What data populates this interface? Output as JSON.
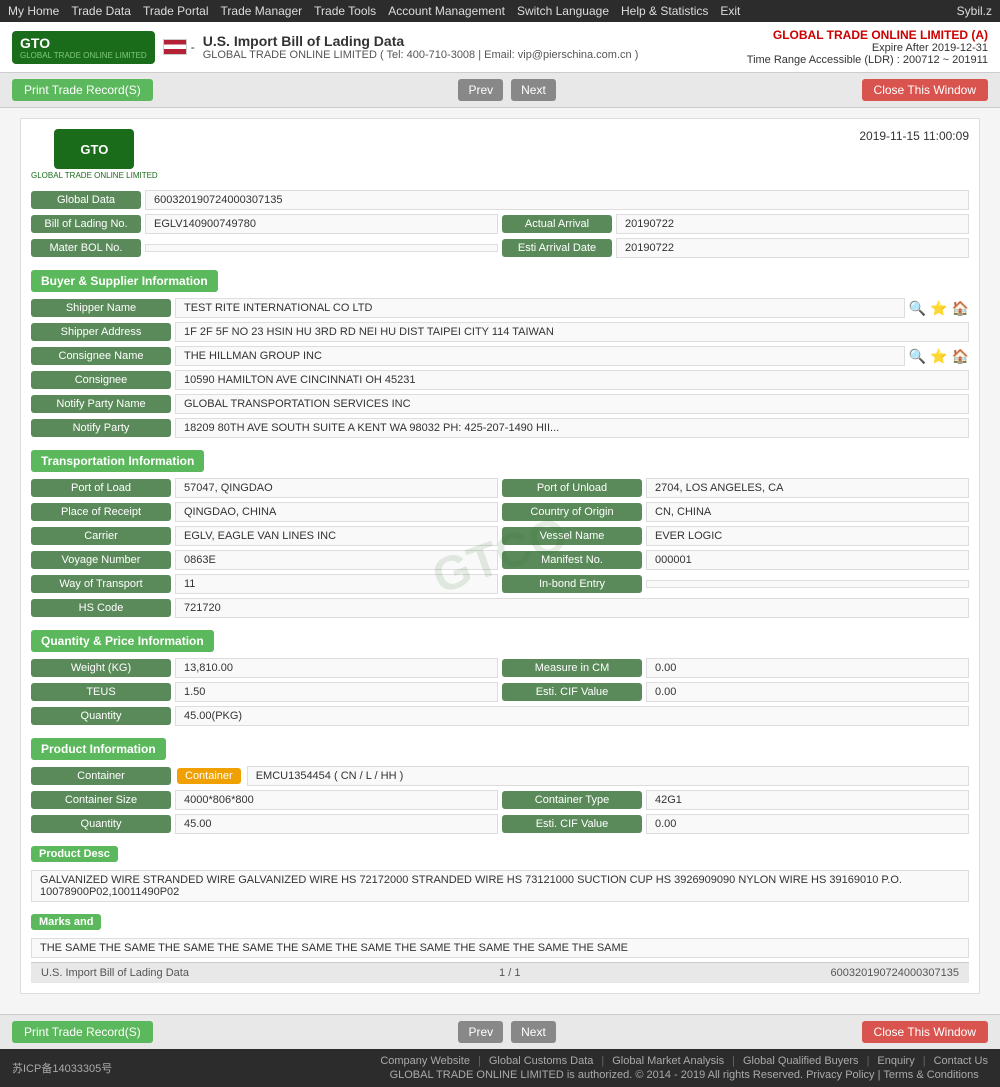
{
  "topnav": {
    "items": [
      "My Home",
      "Trade Data",
      "Trade Portal",
      "Trade Manager",
      "Trade Tools",
      "Account Management",
      "Switch Language",
      "Help & Statistics",
      "Exit"
    ],
    "user": "Sybil.z"
  },
  "header": {
    "logo": "GTO",
    "logo_sub": "GLOBAL TRADE ONLINE LIMITED",
    "title": "U.S. Import Bill of Lading Data",
    "subtitle": "GLOBAL TRADE ONLINE LIMITED ( Tel: 400-710-3008 | Email: vip@pierschina.com.cn )",
    "company": "GLOBAL TRADE ONLINE LIMITED (A)",
    "expire": "Expire After 2019-12-31",
    "time_range": "Time Range Accessible (LDR) : 200712 ~ 201911"
  },
  "toolbar": {
    "print_label": "Print Trade Record(S)",
    "prev_label": "Prev",
    "next_label": "Next",
    "close_label": "Close This Window"
  },
  "card": {
    "timestamp": "2019-11-15 11:00:09",
    "global_data": "600320190724000307135",
    "bol_no_label": "Bill of Lading No.",
    "bol_no": "EGLV140900749780",
    "actual_arrival_label": "Actual Arrival",
    "actual_arrival": "20190722",
    "mater_bol_label": "Mater BOL No.",
    "esti_arrival_label": "Esti Arrival Date",
    "esti_arrival": "20190722"
  },
  "buyer_supplier": {
    "title": "Buyer & Supplier Information",
    "shipper_name_label": "Shipper Name",
    "shipper_name": "TEST RITE INTERNATIONAL CO LTD",
    "shipper_address_label": "Shipper Address",
    "shipper_address": "1F 2F 5F NO 23 HSIN HU 3RD RD NEI HU DIST TAIPEI CITY 114 TAIWAN",
    "consignee_name_label": "Consignee Name",
    "consignee_name": "THE HILLMAN GROUP INC",
    "consignee_label": "Consignee",
    "consignee": "10590 HAMILTON AVE CINCINNATI OH 45231",
    "notify_party_name_label": "Notify Party Name",
    "notify_party_name": "GLOBAL TRANSPORTATION SERVICES INC",
    "notify_party_label": "Notify Party",
    "notify_party": "18209 80TH AVE SOUTH SUITE A KENT WA 98032 PH: 425-207-1490 HII..."
  },
  "transportation": {
    "title": "Transportation Information",
    "port_of_load_label": "Port of Load",
    "port_of_load": "57047, QINGDAO",
    "port_of_unload_label": "Port of Unload",
    "port_of_unload": "2704, LOS ANGELES, CA",
    "place_of_receipt_label": "Place of Receipt",
    "place_of_receipt": "QINGDAO, CHINA",
    "country_of_origin_label": "Country of Origin",
    "country_of_origin": "CN, CHINA",
    "carrier_label": "Carrier",
    "carrier": "EGLV, EAGLE VAN LINES INC",
    "vessel_name_label": "Vessel Name",
    "vessel_name": "EVER LOGIC",
    "voyage_number_label": "Voyage Number",
    "voyage_number": "0863E",
    "manifest_no_label": "Manifest No.",
    "manifest_no": "000001",
    "way_of_transport_label": "Way of Transport",
    "way_of_transport": "11",
    "inbond_entry_label": "In-bond Entry",
    "inbond_entry": "",
    "hs_code_label": "HS Code",
    "hs_code": "721720"
  },
  "quantity_price": {
    "title": "Quantity & Price Information",
    "weight_label": "Weight (KG)",
    "weight": "13,810.00",
    "measure_label": "Measure in CM",
    "measure": "0.00",
    "teus_label": "TEUS",
    "teus": "1.50",
    "esti_cif_label": "Esti. CIF Value",
    "esti_cif": "0.00",
    "quantity_label": "Quantity",
    "quantity": "45.00(PKG)"
  },
  "product_info": {
    "title": "Product Information",
    "container_label": "Container",
    "container": "EMCU1354454 ( CN / L / HH )",
    "container_size_label": "Container Size",
    "container_size": "4000*806*800",
    "container_type_label": "Container Type",
    "container_type": "42G1",
    "quantity_label": "Quantity",
    "quantity": "45.00",
    "esti_cif_label": "Esti. CIF Value",
    "esti_cif": "0.00",
    "product_desc_label": "Product Desc",
    "product_desc": "GALVANIZED WIRE STRANDED WIRE GALVANIZED WIRE HS 72172000 STRANDED WIRE HS 73121000 SUCTION CUP HS 3926909090 NYLON WIRE HS 39169010 P.O. 10078900P02,10011490P02",
    "marks_label": "Marks and",
    "marks": "THE SAME THE SAME THE SAME THE SAME THE SAME THE SAME THE SAME THE SAME THE SAME THE SAME"
  },
  "record_footer": {
    "source": "U.S. Import Bill of Lading Data",
    "page": "1 / 1",
    "record_id": "600320190724000307135"
  },
  "bottom_toolbar": {
    "print_label": "Print Trade Record(S)",
    "prev_label": "Prev",
    "next_label": "Next",
    "close_label": "Close This Window"
  },
  "footer": {
    "icp": "苏ICP备14033305号",
    "links": [
      "Company Website",
      "Global Customs Data",
      "Global Market Analysis",
      "Global Qualified Buyers",
      "Enquiry",
      "Contact Us"
    ],
    "copyright": "GLOBAL TRADE ONLINE LIMITED is authorized. © 2014 - 2019 All rights Reserved.",
    "policy": "Privacy Policy",
    "terms": "Terms & Conditions"
  },
  "watermark": "GTCO"
}
